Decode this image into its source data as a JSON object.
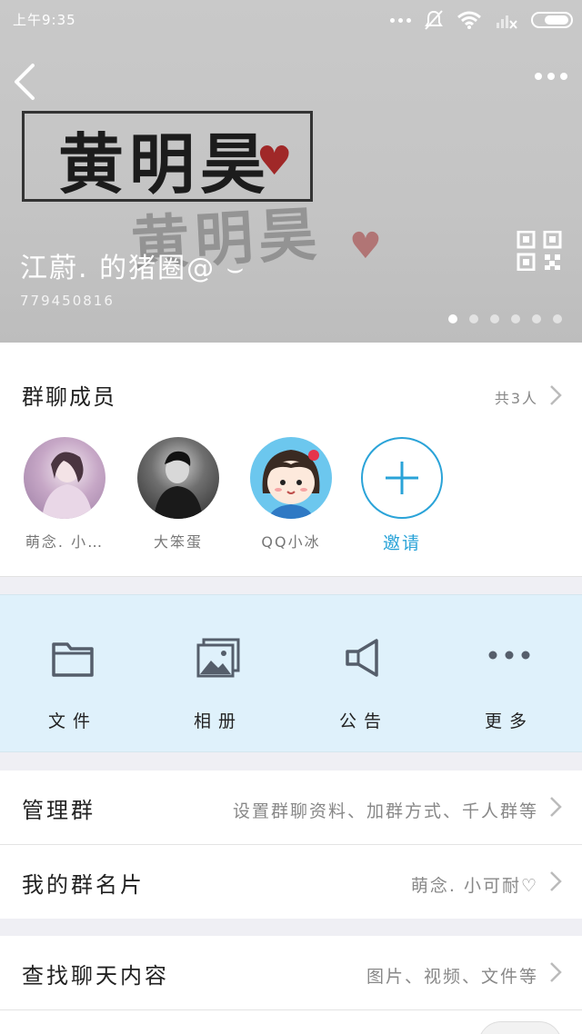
{
  "status_bar": {
    "time": "上午9:35"
  },
  "header": {
    "cover_text": "黄明昊",
    "group_name": "江蔚. 的猪圈@ ⌣",
    "group_id": "779450816",
    "page_dots": 6,
    "active_dot": 0
  },
  "members": {
    "title": "群聊成员",
    "count_label": "共3人",
    "list": [
      {
        "name": "萌念. 小…",
        "avatar": "avatar-girl-photo"
      },
      {
        "name": "大笨蛋",
        "avatar": "avatar-boy-photo"
      },
      {
        "name": "QQ小冰",
        "avatar": "avatar-cartoon-girl"
      }
    ],
    "invite_label": "邀请"
  },
  "actions": [
    {
      "label": "文件",
      "icon": "folder-icon"
    },
    {
      "label": "相册",
      "icon": "photo-album-icon"
    },
    {
      "label": "公告",
      "icon": "megaphone-icon"
    },
    {
      "label": "更多",
      "icon": "more-icon"
    }
  ],
  "rows": {
    "manage": {
      "label": "管理群",
      "value": "设置群聊资料、加群方式、千人群等"
    },
    "card": {
      "label": "我的群名片",
      "value": "萌念. 小可耐♡"
    },
    "search": {
      "label": "查找聊天内容",
      "value": "图片、视频、文件等"
    }
  },
  "colors": {
    "accent": "#2aa3d8",
    "actions_bg": "#dff1fb",
    "page_bg": "#efeff4"
  }
}
